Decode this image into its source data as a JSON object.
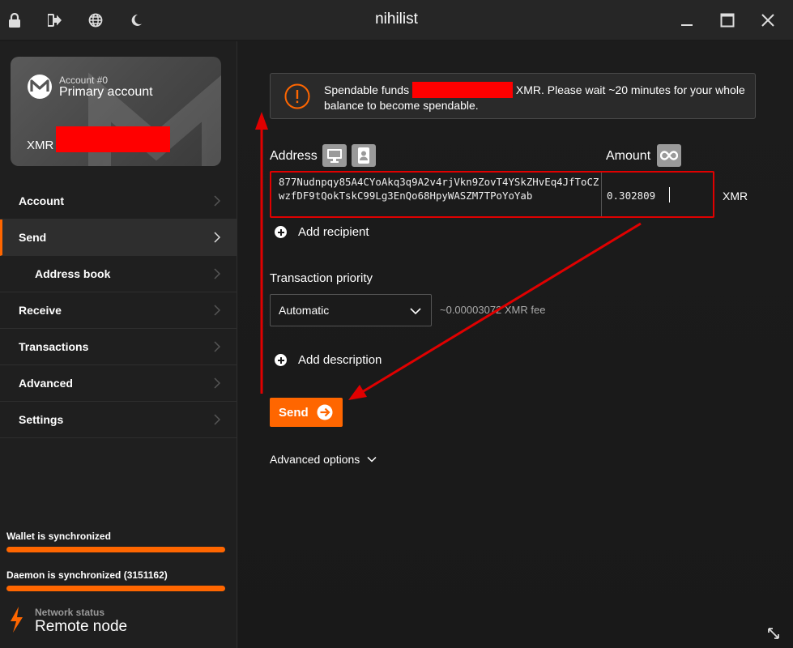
{
  "window": {
    "title": "nihilist",
    "icons": [
      "lock-icon",
      "logout-icon",
      "globe-icon",
      "moon-icon",
      "minimize-icon",
      "maximize-icon",
      "close-icon"
    ]
  },
  "sidebar": {
    "card": {
      "account_number": "Account #0",
      "account_name": "Primary account",
      "balance_currency": "XMR"
    },
    "menu": [
      {
        "label": "Account",
        "active": false,
        "sub": false
      },
      {
        "label": "Send",
        "active": true,
        "sub": false
      },
      {
        "label": "Address book",
        "active": false,
        "sub": true
      },
      {
        "label": "Receive",
        "active": false,
        "sub": false
      },
      {
        "label": "Transactions",
        "active": false,
        "sub": false
      },
      {
        "label": "Advanced",
        "active": false,
        "sub": false
      },
      {
        "label": "Settings",
        "active": false,
        "sub": false
      }
    ],
    "wallet_sync": {
      "label": "Wallet is synchronized",
      "progress": 1.0
    },
    "daemon_sync": {
      "label": "Daemon is synchronized (3151162)",
      "progress": 1.0
    },
    "network": {
      "label": "Network status",
      "value": "Remote node"
    }
  },
  "main": {
    "notice": {
      "text_before": "Spendable funds ",
      "text_after": " XMR. Please wait ~20 minutes for your whole balance to become spendable."
    },
    "address_label": "Address",
    "amount_label": "Amount",
    "address_value": "877Nudnpqy85A4CYoAkq3q9A2v4rjVkn9ZovT4YSkZHvEq4JfToCZwzfDF9tQokTskC99Lg3EnQo68HpyWASZM7TPoYoYab",
    "amount_value": "0.302809",
    "amount_unit": "XMR",
    "add_recipient": "Add recipient",
    "priority_label": "Transaction priority",
    "priority_value": "Automatic",
    "fee": "~0.00003072 XMR fee",
    "add_description": "Add description",
    "send_label": "Send",
    "advanced_options": "Advanced options"
  },
  "colors": {
    "accent": "#ff6600",
    "annotation": "#e00000",
    "redaction": "#ff0000"
  }
}
